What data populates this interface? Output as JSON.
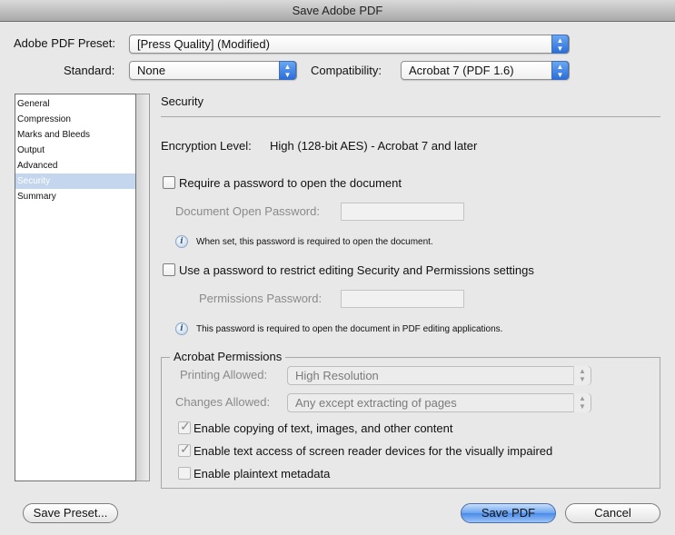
{
  "window": {
    "title": "Save Adobe PDF"
  },
  "preset": {
    "label": "Adobe PDF Preset:",
    "value": "[Press Quality] (Modified)"
  },
  "standard": {
    "label": "Standard:",
    "value": "None"
  },
  "compatibility": {
    "label": "Compatibility:",
    "value": "Acrobat 7 (PDF 1.6)"
  },
  "sidebar": {
    "items": [
      {
        "label": "General"
      },
      {
        "label": "Compression"
      },
      {
        "label": "Marks and Bleeds"
      },
      {
        "label": "Output"
      },
      {
        "label": "Advanced"
      },
      {
        "label": "Security"
      },
      {
        "label": "Summary"
      }
    ],
    "selected": "Security"
  },
  "panel": {
    "title": "Security",
    "encryption_label": "Encryption Level:",
    "encryption_value": "High (128-bit AES) - Acrobat 7 and later",
    "open_password": {
      "checkbox_label": "Require a password to open the document",
      "checked": false,
      "field_label": "Document Open Password:",
      "field_value": "",
      "note": "When set, this password is required to open the document."
    },
    "permissions_password": {
      "checkbox_label": "Use a password to restrict editing Security and Permissions settings",
      "checked": false,
      "field_label": "Permissions Password:",
      "field_value": "",
      "note": "This password is required to open the document in PDF editing applications."
    },
    "permissions": {
      "group_label": "Acrobat Permissions",
      "printing_label": "Printing Allowed:",
      "printing_value": "High Resolution",
      "changes_label": "Changes Allowed:",
      "changes_value": "Any except extracting of pages",
      "copy_label": "Enable copying of text, images, and other content",
      "copy_checked": true,
      "screen_reader_label": "Enable text access of screen reader devices for the visually impaired",
      "screen_reader_checked": true,
      "metadata_label": "Enable plaintext metadata",
      "metadata_checked": false
    }
  },
  "buttons": {
    "save_preset": "Save Preset...",
    "save_pdf": "Save PDF",
    "cancel": "Cancel"
  },
  "icons": {
    "popup_arrows": "up-down-arrows-icon",
    "info": "info-icon",
    "check": "checkmark-icon"
  },
  "colors": {
    "accent_blue": "#4a8ae8",
    "selection": "#c4d6ee",
    "window_bg": "#e8e8e8"
  }
}
